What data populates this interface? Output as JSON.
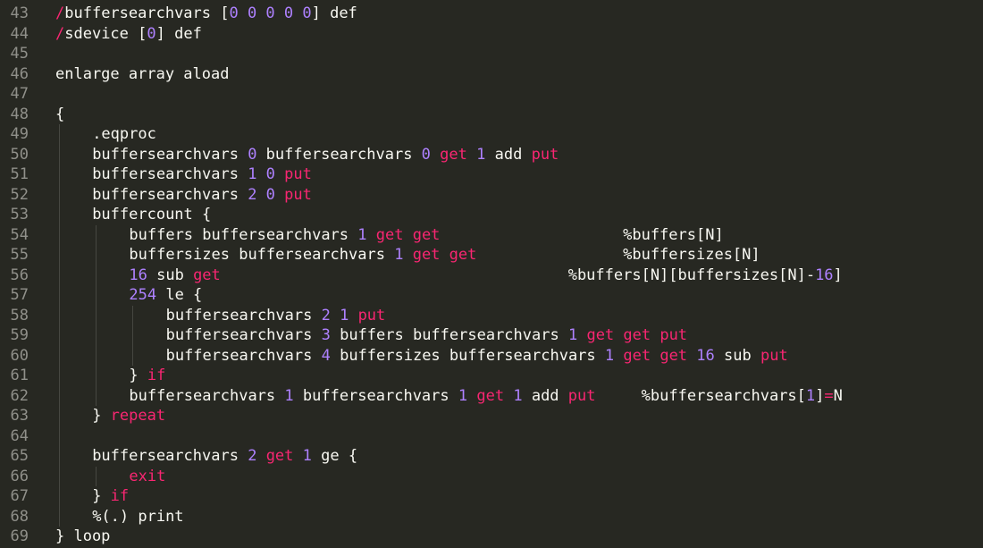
{
  "editor": {
    "colors": {
      "background": "#272822",
      "text": "#f8f8f2",
      "gutter": "#90908a",
      "keyword": "#f92672",
      "number": "#ae81ff",
      "indent_guide": "#464741"
    },
    "lines": [
      {
        "number": "43",
        "indent": 0,
        "tokens": [
          {
            "t": "/",
            "c": "kw"
          },
          {
            "t": "buffersearchvars [",
            "c": "plain"
          },
          {
            "t": "0 0 0 0 0",
            "c": "num"
          },
          {
            "t": "] def",
            "c": "plain"
          }
        ]
      },
      {
        "number": "44",
        "indent": 0,
        "tokens": [
          {
            "t": "/",
            "c": "kw"
          },
          {
            "t": "sdevice [",
            "c": "plain"
          },
          {
            "t": "0",
            "c": "num"
          },
          {
            "t": "] def",
            "c": "plain"
          }
        ]
      },
      {
        "number": "45",
        "indent": 0,
        "tokens": []
      },
      {
        "number": "46",
        "indent": 0,
        "tokens": [
          {
            "t": "enlarge array aload",
            "c": "plain"
          }
        ]
      },
      {
        "number": "47",
        "indent": 0,
        "tokens": []
      },
      {
        "number": "48",
        "indent": 0,
        "tokens": [
          {
            "t": "{",
            "c": "plain"
          }
        ]
      },
      {
        "number": "49",
        "indent": 1,
        "tokens": [
          {
            "t": ".eqproc",
            "c": "plain"
          }
        ]
      },
      {
        "number": "50",
        "indent": 1,
        "tokens": [
          {
            "t": "buffersearchvars ",
            "c": "plain"
          },
          {
            "t": "0",
            "c": "num"
          },
          {
            "t": " buffersearchvars ",
            "c": "plain"
          },
          {
            "t": "0",
            "c": "num"
          },
          {
            "t": " ",
            "c": "plain"
          },
          {
            "t": "get",
            "c": "kw"
          },
          {
            "t": " ",
            "c": "plain"
          },
          {
            "t": "1",
            "c": "num"
          },
          {
            "t": " add ",
            "c": "plain"
          },
          {
            "t": "put",
            "c": "kw"
          }
        ]
      },
      {
        "number": "51",
        "indent": 1,
        "tokens": [
          {
            "t": "buffersearchvars ",
            "c": "plain"
          },
          {
            "t": "1 0",
            "c": "num"
          },
          {
            "t": " ",
            "c": "plain"
          },
          {
            "t": "put",
            "c": "kw"
          }
        ]
      },
      {
        "number": "52",
        "indent": 1,
        "tokens": [
          {
            "t": "buffersearchvars ",
            "c": "plain"
          },
          {
            "t": "2 0",
            "c": "num"
          },
          {
            "t": " ",
            "c": "plain"
          },
          {
            "t": "put",
            "c": "kw"
          }
        ]
      },
      {
        "number": "53",
        "indent": 1,
        "tokens": [
          {
            "t": "buffercount {",
            "c": "plain"
          }
        ]
      },
      {
        "number": "54",
        "indent": 2,
        "tokens": [
          {
            "t": "buffers buffersearchvars ",
            "c": "plain"
          },
          {
            "t": "1",
            "c": "num"
          },
          {
            "t": " ",
            "c": "plain"
          },
          {
            "t": "get get",
            "c": "kw"
          },
          {
            "t": "                    %buffers[N]",
            "c": "plain"
          }
        ]
      },
      {
        "number": "55",
        "indent": 2,
        "tokens": [
          {
            "t": "buffersizes buffersearchvars ",
            "c": "plain"
          },
          {
            "t": "1",
            "c": "num"
          },
          {
            "t": " ",
            "c": "plain"
          },
          {
            "t": "get get",
            "c": "kw"
          },
          {
            "t": "                %buffersizes[N]",
            "c": "plain"
          }
        ]
      },
      {
        "number": "56",
        "indent": 2,
        "tokens": [
          {
            "t": "16",
            "c": "num"
          },
          {
            "t": " sub ",
            "c": "plain"
          },
          {
            "t": "get",
            "c": "kw"
          },
          {
            "t": "                                      %buffers[N][buffersizes[N]-",
            "c": "plain"
          },
          {
            "t": "16",
            "c": "num"
          },
          {
            "t": "]",
            "c": "plain"
          }
        ]
      },
      {
        "number": "57",
        "indent": 2,
        "tokens": [
          {
            "t": "254",
            "c": "num"
          },
          {
            "t": " le {",
            "c": "plain"
          }
        ]
      },
      {
        "number": "58",
        "indent": 3,
        "tokens": [
          {
            "t": "buffersearchvars ",
            "c": "plain"
          },
          {
            "t": "2 1",
            "c": "num"
          },
          {
            "t": " ",
            "c": "plain"
          },
          {
            "t": "put",
            "c": "kw"
          }
        ]
      },
      {
        "number": "59",
        "indent": 3,
        "tokens": [
          {
            "t": "buffersearchvars ",
            "c": "plain"
          },
          {
            "t": "3",
            "c": "num"
          },
          {
            "t": " buffers buffersearchvars ",
            "c": "plain"
          },
          {
            "t": "1",
            "c": "num"
          },
          {
            "t": " ",
            "c": "plain"
          },
          {
            "t": "get get put",
            "c": "kw"
          }
        ]
      },
      {
        "number": "60",
        "indent": 3,
        "tokens": [
          {
            "t": "buffersearchvars ",
            "c": "plain"
          },
          {
            "t": "4",
            "c": "num"
          },
          {
            "t": " buffersizes buffersearchvars ",
            "c": "plain"
          },
          {
            "t": "1",
            "c": "num"
          },
          {
            "t": " ",
            "c": "plain"
          },
          {
            "t": "get get",
            "c": "kw"
          },
          {
            "t": " ",
            "c": "plain"
          },
          {
            "t": "16",
            "c": "num"
          },
          {
            "t": " sub ",
            "c": "plain"
          },
          {
            "t": "put",
            "c": "kw"
          }
        ]
      },
      {
        "number": "61",
        "indent": 2,
        "tokens": [
          {
            "t": "} ",
            "c": "plain"
          },
          {
            "t": "if",
            "c": "kw"
          }
        ]
      },
      {
        "number": "62",
        "indent": 2,
        "tokens": [
          {
            "t": "buffersearchvars ",
            "c": "plain"
          },
          {
            "t": "1",
            "c": "num"
          },
          {
            "t": " buffersearchvars ",
            "c": "plain"
          },
          {
            "t": "1",
            "c": "num"
          },
          {
            "t": " ",
            "c": "plain"
          },
          {
            "t": "get",
            "c": "kw"
          },
          {
            "t": " ",
            "c": "plain"
          },
          {
            "t": "1",
            "c": "num"
          },
          {
            "t": " add ",
            "c": "plain"
          },
          {
            "t": "put",
            "c": "kw"
          },
          {
            "t": "     %buffersearchvars[",
            "c": "plain"
          },
          {
            "t": "1",
            "c": "num"
          },
          {
            "t": "]",
            "c": "plain"
          },
          {
            "t": "=",
            "c": "kw"
          },
          {
            "t": "N",
            "c": "plain"
          }
        ]
      },
      {
        "number": "63",
        "indent": 1,
        "tokens": [
          {
            "t": "} ",
            "c": "plain"
          },
          {
            "t": "repeat",
            "c": "kw"
          }
        ]
      },
      {
        "number": "64",
        "indent": 1,
        "tokens": []
      },
      {
        "number": "65",
        "indent": 1,
        "tokens": [
          {
            "t": "buffersearchvars ",
            "c": "plain"
          },
          {
            "t": "2",
            "c": "num"
          },
          {
            "t": " ",
            "c": "plain"
          },
          {
            "t": "get",
            "c": "kw"
          },
          {
            "t": " ",
            "c": "plain"
          },
          {
            "t": "1",
            "c": "num"
          },
          {
            "t": " ge {",
            "c": "plain"
          }
        ]
      },
      {
        "number": "66",
        "indent": 2,
        "tokens": [
          {
            "t": "exit",
            "c": "kw"
          }
        ]
      },
      {
        "number": "67",
        "indent": 1,
        "tokens": [
          {
            "t": "} ",
            "c": "plain"
          },
          {
            "t": "if",
            "c": "kw"
          }
        ]
      },
      {
        "number": "68",
        "indent": 1,
        "tokens": [
          {
            "t": "%(.) print",
            "c": "plain"
          }
        ]
      },
      {
        "number": "69",
        "indent": 0,
        "tokens": [
          {
            "t": "} loop",
            "c": "plain"
          }
        ]
      }
    ]
  }
}
